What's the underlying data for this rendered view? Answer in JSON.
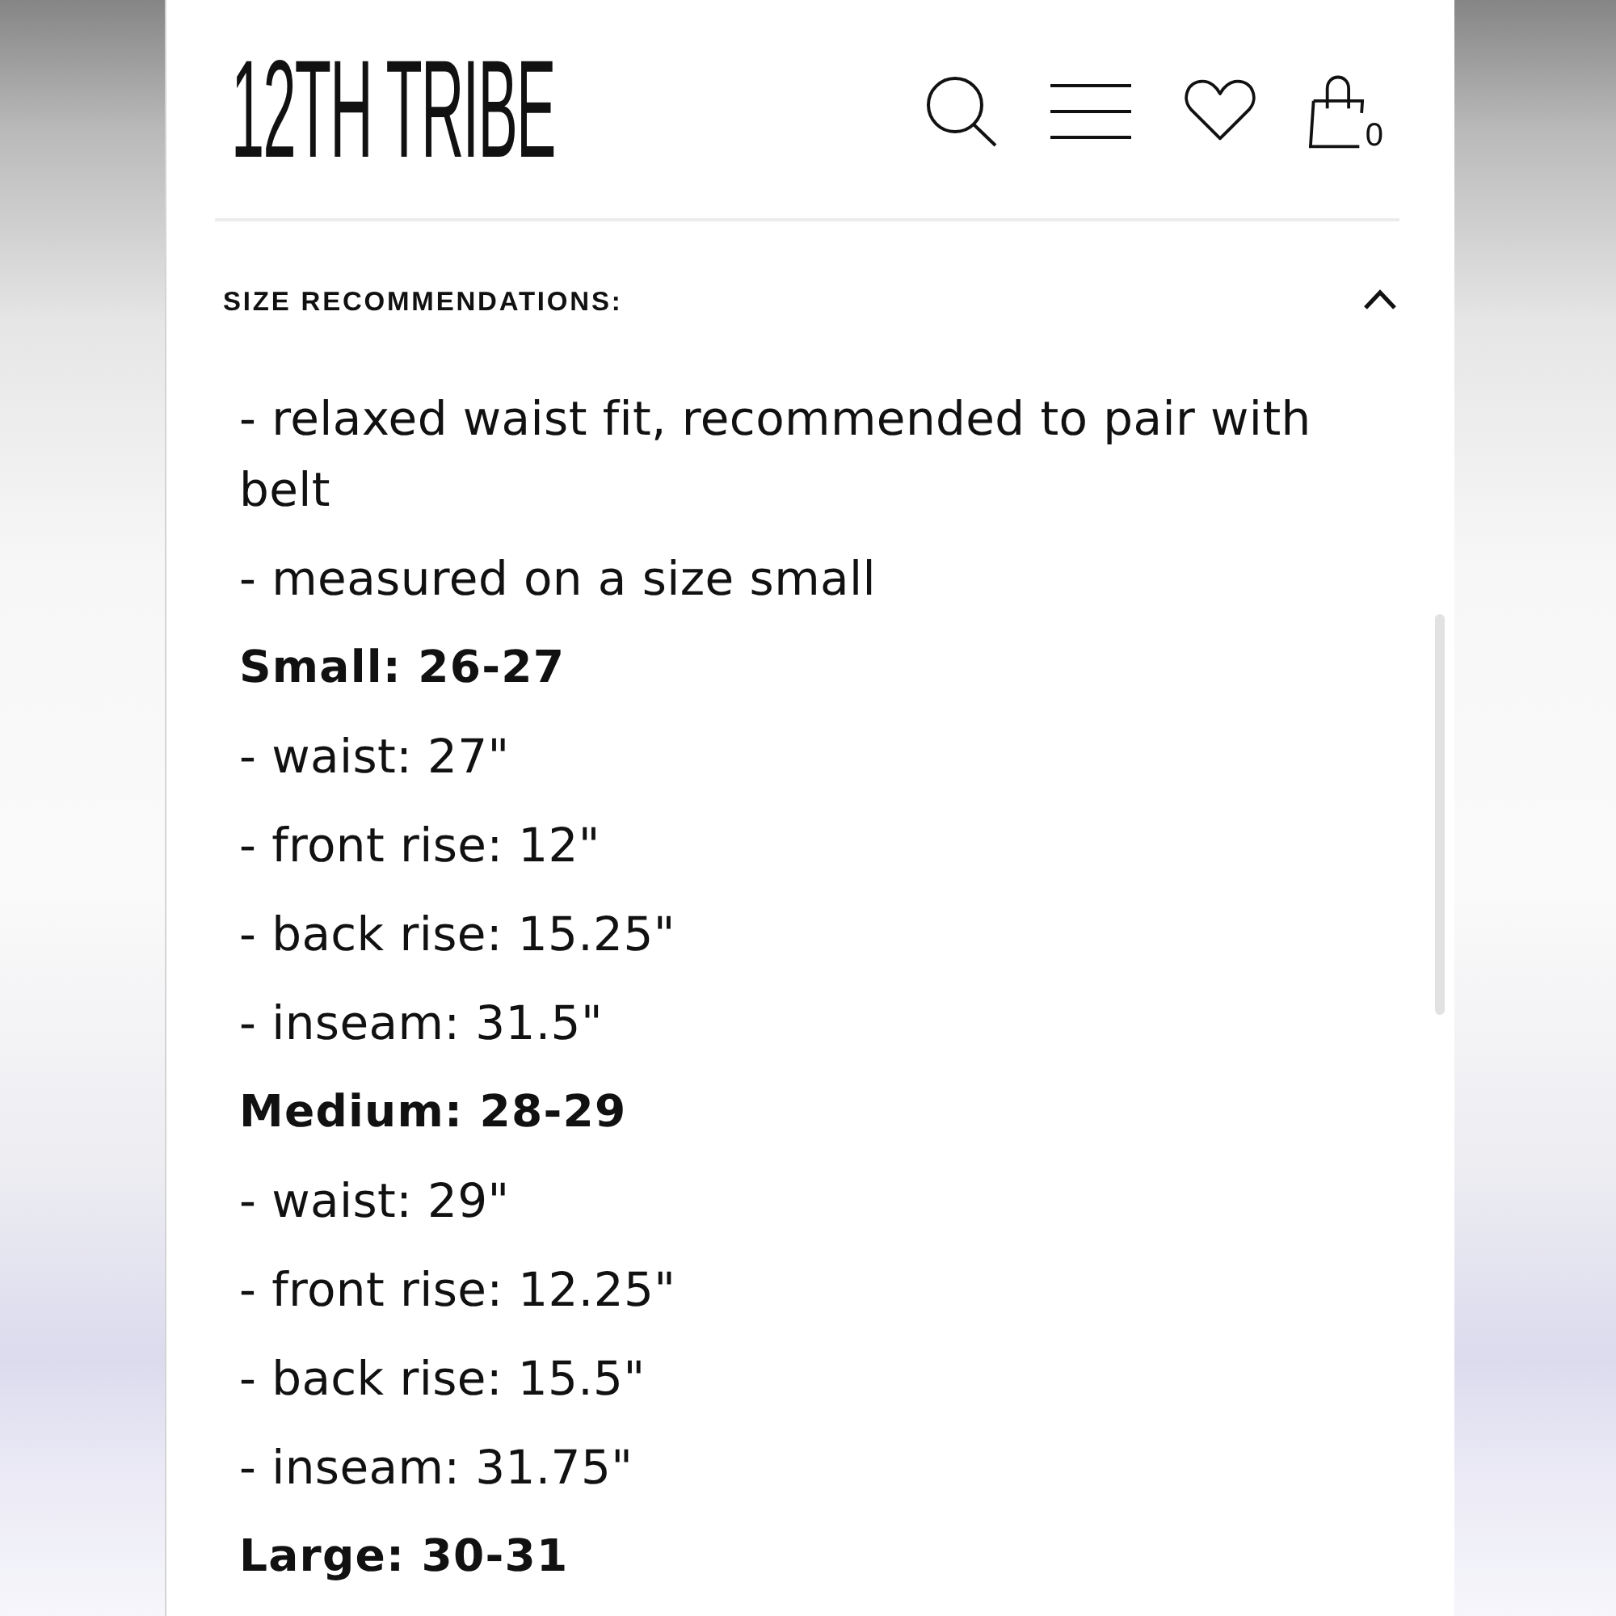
{
  "header": {
    "logo": "12TH TRIBE",
    "cart_count": "0"
  },
  "accordion": {
    "title": "SIZE RECOMMENDATIONS:",
    "expanded": true,
    "paragraphs": [
      {
        "kind": "note",
        "text": "- relaxed waist fit, recommended to pair with belt"
      },
      {
        "kind": "note",
        "text": "- measured on a size small"
      },
      {
        "kind": "size",
        "text": "Small: 26-27"
      },
      {
        "kind": "note",
        "text": "- waist: 27\""
      },
      {
        "kind": "note",
        "text": "- front rise: 12\""
      },
      {
        "kind": "note",
        "text": "- back rise: 15.25\""
      },
      {
        "kind": "note",
        "text": "- inseam: 31.5\""
      },
      {
        "kind": "size",
        "text": "Medium: 28-29"
      },
      {
        "kind": "note",
        "text": "- waist: 29\""
      },
      {
        "kind": "note",
        "text": "- front rise: 12.25\""
      },
      {
        "kind": "note",
        "text": "- back rise: 15.5\""
      },
      {
        "kind": "note",
        "text": "- inseam: 31.75\""
      },
      {
        "kind": "size",
        "text": "Large: 30-31"
      }
    ]
  }
}
